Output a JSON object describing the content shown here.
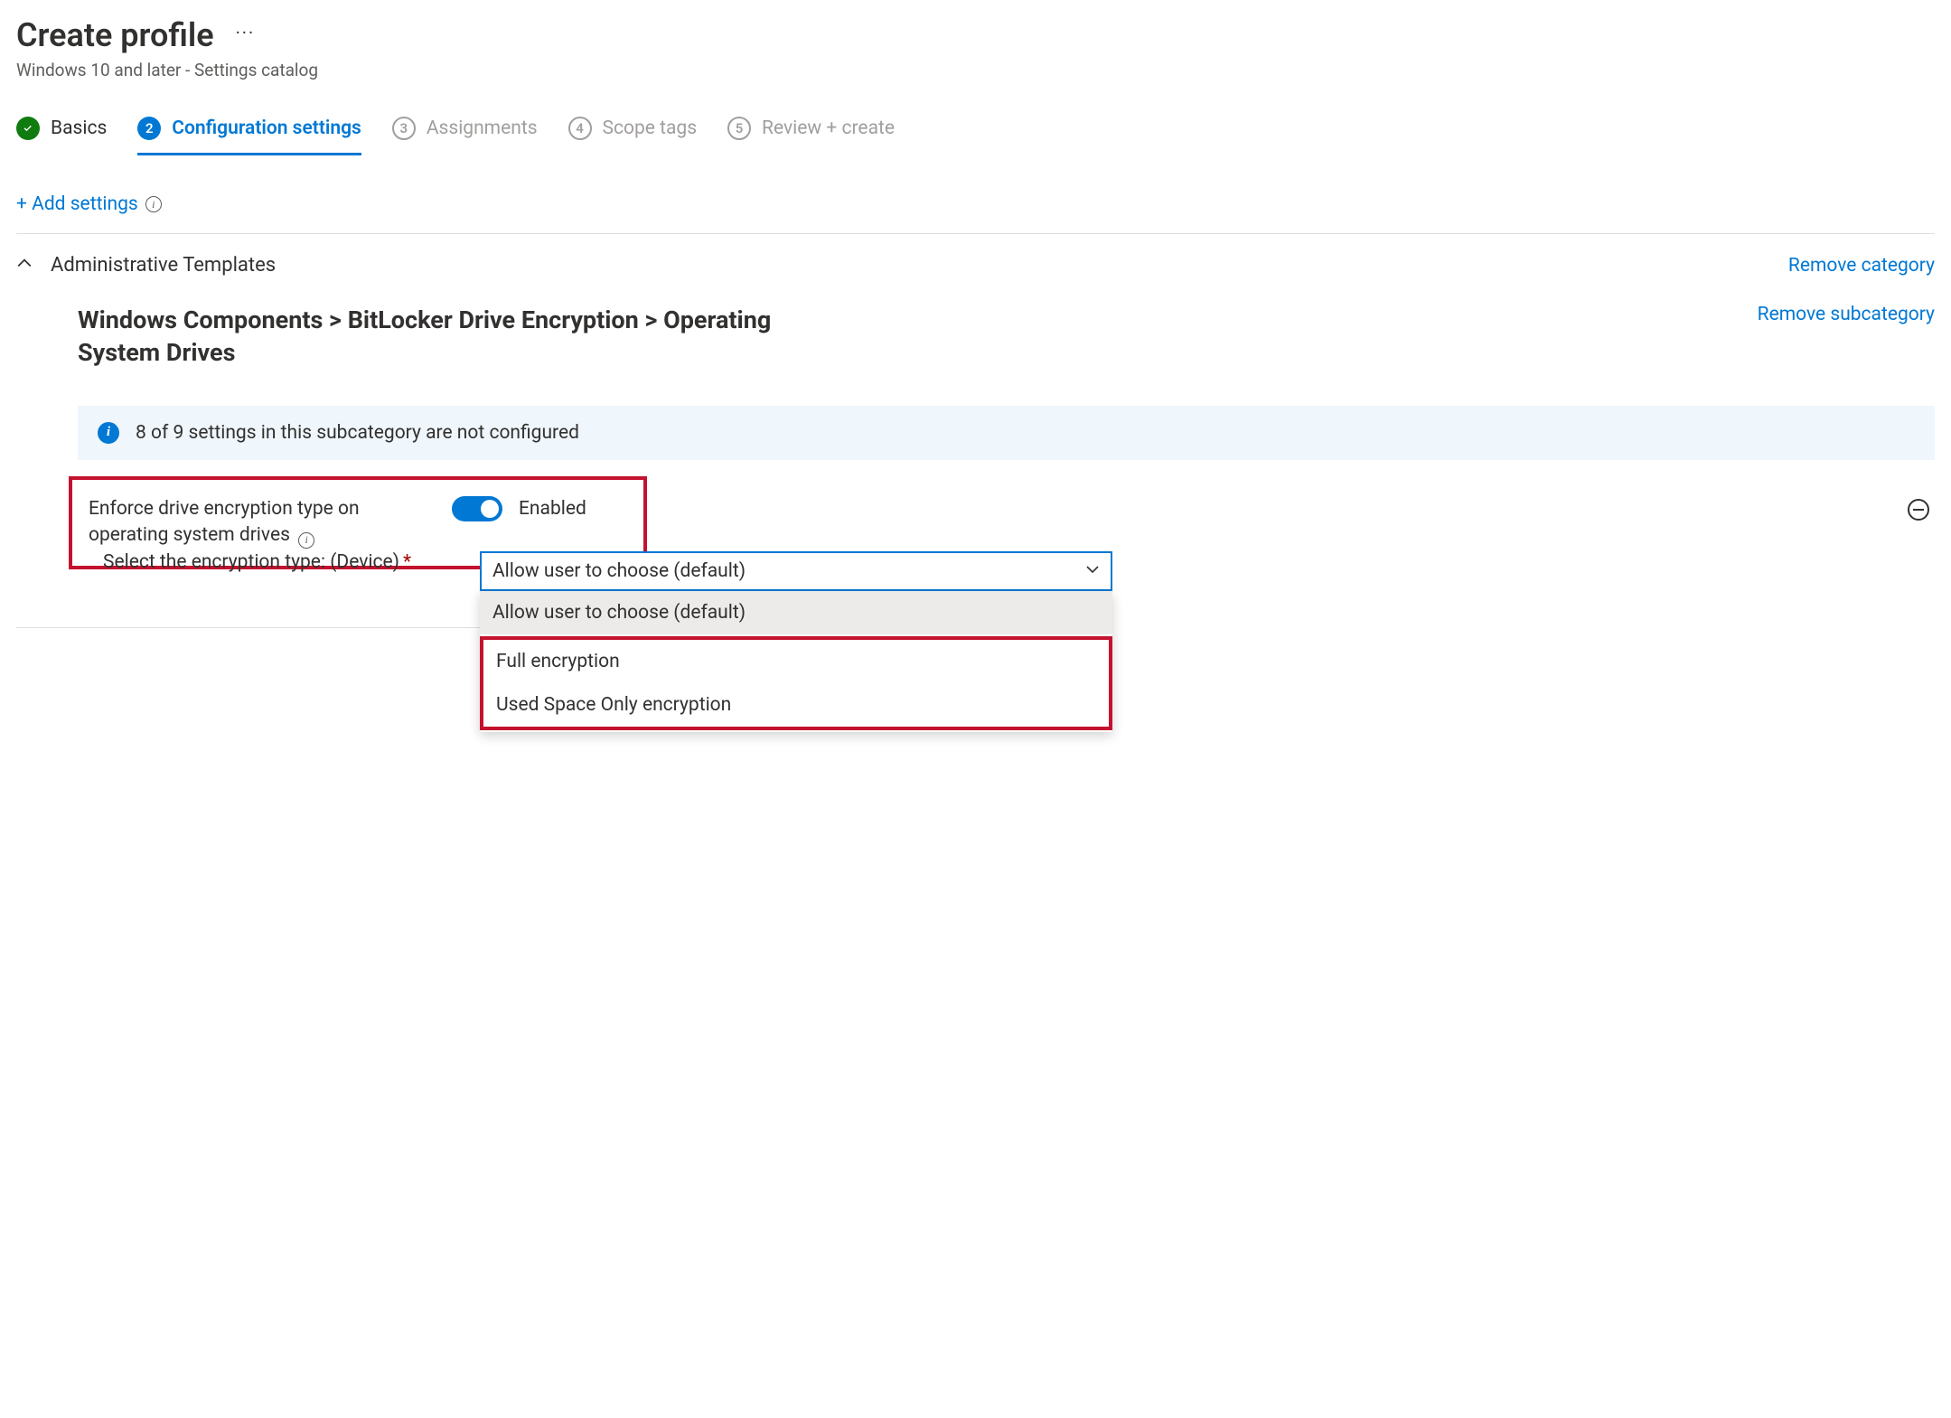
{
  "header": {
    "title": "Create profile",
    "subtitle": "Windows 10 and later - Settings catalog"
  },
  "stepper": {
    "steps": [
      {
        "num": "✓",
        "label": "Basics",
        "state": "done"
      },
      {
        "num": "2",
        "label": "Configuration settings",
        "state": "current"
      },
      {
        "num": "3",
        "label": "Assignments",
        "state": "future"
      },
      {
        "num": "4",
        "label": "Scope tags",
        "state": "future"
      },
      {
        "num": "5",
        "label": "Review + create",
        "state": "future"
      }
    ]
  },
  "actions": {
    "add_settings": "+ Add settings",
    "remove_category": "Remove category",
    "remove_subcategory": "Remove subcategory"
  },
  "category": {
    "title": "Administrative Templates"
  },
  "subcategory": {
    "title": "Windows Components > BitLocker Drive Encryption > Operating System Drives"
  },
  "banner": {
    "text": "8 of 9 settings in this subcategory are not configured"
  },
  "setting_enforce": {
    "label": "Enforce drive encryption type on operating system drives",
    "toggle_state": "Enabled"
  },
  "field_encryption_type": {
    "label": "Select the encryption type: (Device)",
    "selected": "Allow user to choose (default)",
    "options": [
      "Allow user to choose (default)",
      "Full encryption",
      "Used Space Only encryption"
    ]
  }
}
